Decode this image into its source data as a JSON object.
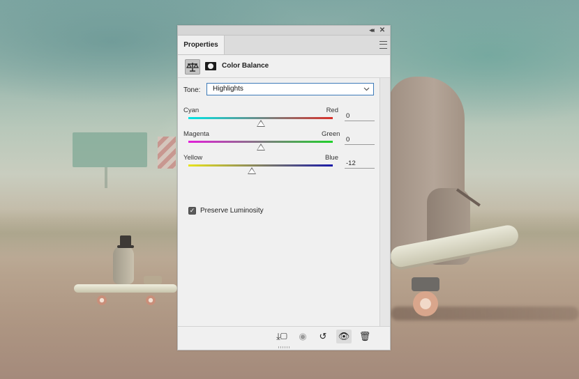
{
  "window": {
    "collapse_glyph": "◂◂",
    "close_glyph": "✕"
  },
  "tabs": [
    {
      "label": "Properties"
    }
  ],
  "header": {
    "title": "Color Balance",
    "icons": [
      "color-balance-icon",
      "layer-mask-icon"
    ]
  },
  "tone": {
    "label": "Tone:",
    "selected": "Highlights"
  },
  "sliders": [
    {
      "left_label": "Cyan",
      "right_label": "Red",
      "value": "0",
      "position": 0.5,
      "colors": [
        "#00e5e5",
        "#d9302a"
      ]
    },
    {
      "left_label": "Magenta",
      "right_label": "Green",
      "value": "0",
      "position": 0.5,
      "colors": [
        "#e21fd9",
        "#1fd12a"
      ]
    },
    {
      "left_label": "Yellow",
      "right_label": "Blue",
      "value": "-12",
      "position": 0.44,
      "colors": [
        "#e8e41c",
        "#1a1aa8"
      ]
    }
  ],
  "preserve_luminosity": {
    "label": "Preserve Luminosity",
    "checked": true,
    "check_glyph": "✓"
  },
  "footer": {
    "buttons": [
      {
        "name": "clip-to-layer-icon",
        "glyph": "⤓▢",
        "active": false,
        "dim": false
      },
      {
        "name": "view-previous-state-icon",
        "glyph": "◉",
        "active": false,
        "dim": true
      },
      {
        "name": "reset-icon",
        "glyph": "↺",
        "active": false,
        "dim": false
      },
      {
        "name": "toggle-visibility-icon",
        "glyph": "👁",
        "active": true,
        "dim": false
      },
      {
        "name": "delete-icon",
        "glyph": "🗑",
        "active": false,
        "dim": false
      }
    ]
  }
}
